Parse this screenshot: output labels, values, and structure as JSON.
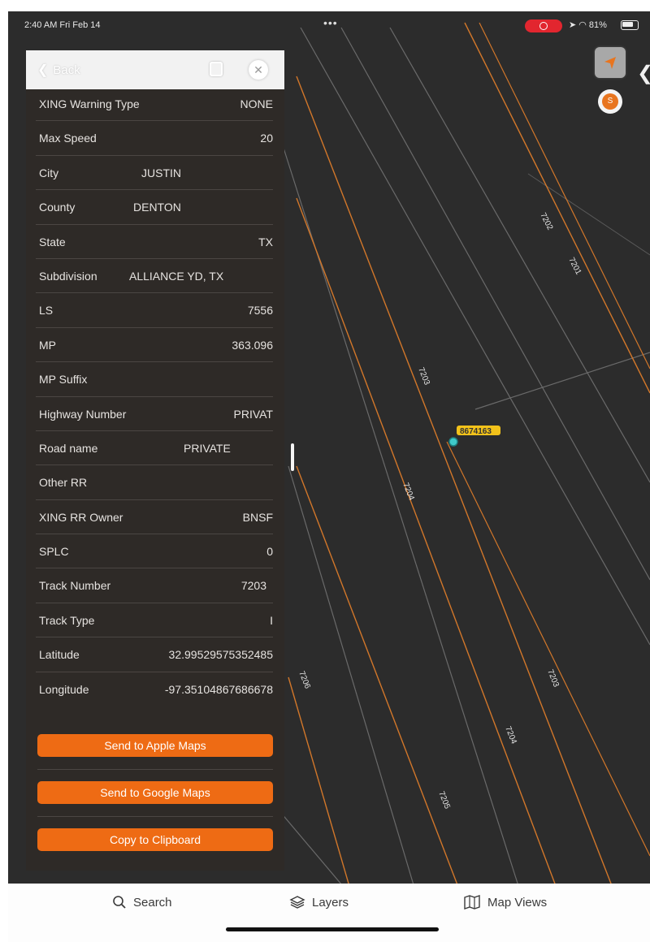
{
  "status_bar": {
    "time": "2:40 AM  Fri Feb 14",
    "dots": "•••",
    "right": "➤ ◠ 81%",
    "battery_percent": 81,
    "recording_color": "#e2262f"
  },
  "panel": {
    "back_label": "Back",
    "rows": [
      {
        "key": "XING Warning Type",
        "value": "NONE",
        "align": "right"
      },
      {
        "key": "Max Speed",
        "value": "20",
        "align": "right"
      },
      {
        "key": "City",
        "value": "JUSTIN",
        "align": "center"
      },
      {
        "key": "County",
        "value": "DENTON",
        "align": "center"
      },
      {
        "key": "State",
        "value": "TX",
        "align": "right"
      },
      {
        "key": "Subdivision",
        "value": "ALLIANCE YD, TX",
        "align": "center"
      },
      {
        "key": "LS",
        "value": "7556",
        "align": "right"
      },
      {
        "key": "MP",
        "value": "363.096",
        "align": "right"
      },
      {
        "key": "MP Suffix",
        "value": "",
        "align": "right"
      },
      {
        "key": "Highway Number",
        "value": "PRIVAT",
        "align": "right"
      },
      {
        "key": "Road name",
        "value": "PRIVATE",
        "align": "center"
      },
      {
        "key": "Other RR",
        "value": "",
        "align": "right"
      },
      {
        "key": "XING RR Owner",
        "value": "BNSF",
        "align": "right"
      },
      {
        "key": "SPLC",
        "value": "0",
        "align": "right"
      },
      {
        "key": "Track Number",
        "value": "7203",
        "align": "right"
      },
      {
        "key": "Track Type",
        "value": "I",
        "align": "right"
      },
      {
        "key": "Latitude",
        "value": "32.99529575352485",
        "align": "right"
      },
      {
        "key": "Longitude",
        "value": "-97.35104867686678",
        "align": "right"
      }
    ],
    "buttons": {
      "apple": "Send to Apple Maps",
      "google": "Send to Google Maps",
      "clipboard": "Copy to Clipboard"
    },
    "accent_color": "#ee6b14"
  },
  "map": {
    "track_labels": [
      "7202",
      "7201",
      "7203",
      "7204",
      "7203",
      "7204",
      "7205",
      "7206"
    ],
    "crossing_label": "8674163",
    "rail_color": "#d2772a"
  },
  "tabbar": {
    "search": "Search",
    "layers": "Layers",
    "map_views": "Map Views"
  }
}
